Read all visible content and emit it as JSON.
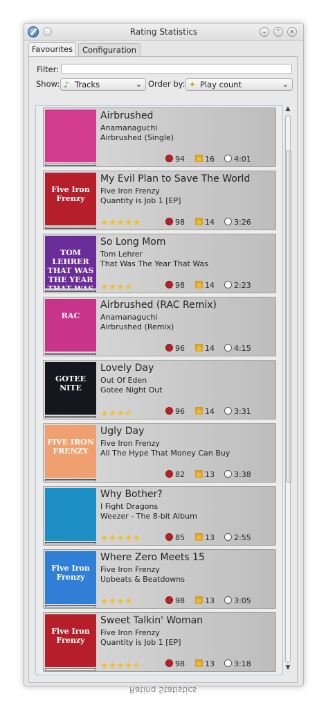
{
  "window": {
    "title": "Rating Statistics"
  },
  "tabs": [
    {
      "label": "Favourites"
    },
    {
      "label": "Configuration"
    }
  ],
  "filter": {
    "label": "Filter:",
    "value": ""
  },
  "show": {
    "label": "Show:",
    "value": "Tracks"
  },
  "order": {
    "label": "Order by:",
    "value": "Play count"
  },
  "tracks": [
    {
      "title": "Airbrushed",
      "artist": "Anamanaguchi",
      "album": "Airbrushed (Single)",
      "stars": "",
      "score": "94",
      "plays": "16",
      "length": "4:01"
    },
    {
      "title": "My Evil Plan to Save The World",
      "artist": "Five Iron Frenzy",
      "album": "Quantity is Job 1 [EP]",
      "stars": "★★★★★",
      "score": "98",
      "plays": "14",
      "length": "3:26"
    },
    {
      "title": "So Long Mom",
      "artist": "Tom Lehrer",
      "album": "That Was The Year That Was",
      "stars": "★★★⯪",
      "score": "98",
      "plays": "14",
      "length": "2:23"
    },
    {
      "title": "Airbrushed (RAC Remix)",
      "artist": "Anamanaguchi",
      "album": "Airbrushed (Remix)",
      "stars": "",
      "score": "96",
      "plays": "14",
      "length": "4:15"
    },
    {
      "title": "Lovely Day",
      "artist": "Out Of Eden",
      "album": "Gotee Night Out",
      "stars": "★★★⯪",
      "score": "96",
      "plays": "14",
      "length": "3:31"
    },
    {
      "title": "Ugly Day",
      "artist": "Five Iron Frenzy",
      "album": "All The Hype That Money Can Buy",
      "stars": "",
      "score": "82",
      "plays": "13",
      "length": "3:38"
    },
    {
      "title": "Why Bother?",
      "artist": "I Fight Dragons",
      "album": "Weezer - The 8-bit Album",
      "stars": "★★★★★",
      "score": "85",
      "plays": "13",
      "length": "2:55"
    },
    {
      "title": "Where Zero Meets 15",
      "artist": "Five Iron Frenzy",
      "album": "Upbeats & Beatdowns",
      "stars": "★★★★",
      "score": "98",
      "plays": "13",
      "length": "3:05"
    },
    {
      "title": "Sweet Talkin' Woman",
      "artist": "Five Iron Frenzy",
      "album": "Quantity is Job 1 [EP]",
      "stars": "★★★★⯪",
      "score": "98",
      "plays": "13",
      "length": "3:18"
    }
  ],
  "covers": [
    {
      "text": "",
      "bg": "#d23b8f"
    },
    {
      "text": "Five Iron Frenzy",
      "bg": "#b61f2a"
    },
    {
      "text": "TOM LEHRER  THAT WAS THE YEAR THAT WAS",
      "bg": "#6a2c98"
    },
    {
      "text": "RAC",
      "bg": "#c8348a"
    },
    {
      "text": "GOTEE NITE",
      "bg": "#15161e"
    },
    {
      "text": "FIVE IRON FRENZY",
      "bg": "#f0a070"
    },
    {
      "text": "",
      "bg": "#1e8fc4"
    },
    {
      "text": "Five Iron Frenzy",
      "bg": "#2f7fd6"
    },
    {
      "text": "Five Iron Frenzy",
      "bg": "#b61f2a"
    }
  ],
  "icons": {
    "show": "music-note-icon",
    "order": "play-count-icon",
    "score": "heart-icon",
    "plays": "play-count-icon",
    "length": "clock-icon"
  },
  "colors": {
    "accent": "#aac4df",
    "star": "#f0c02a",
    "score": "#b82222"
  }
}
